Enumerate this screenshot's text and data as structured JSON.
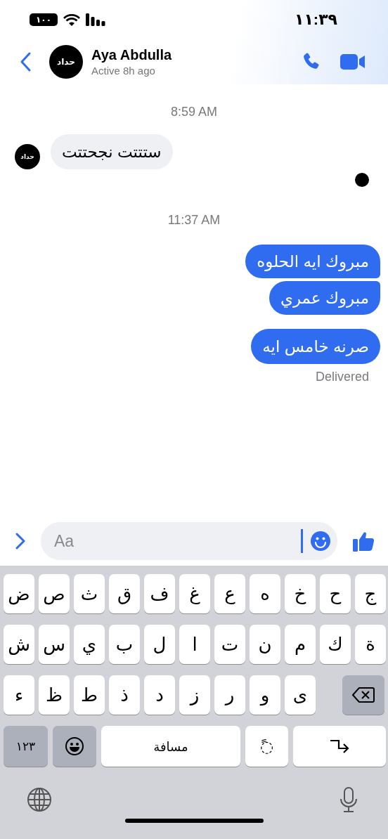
{
  "status_bar": {
    "battery": "١٠٠",
    "time": "١١:٣٩"
  },
  "header": {
    "avatar_text": "حداد",
    "name": "Aya Abdulla",
    "status": "Active 8h ago"
  },
  "messages": [
    {
      "kind": "time",
      "text": "8:59 AM"
    },
    {
      "kind": "received",
      "text": "ستتتت نجحتتت",
      "avatar_text": "حداد"
    },
    {
      "kind": "seen"
    },
    {
      "kind": "time",
      "text": "11:37 AM"
    },
    {
      "kind": "sent",
      "text": "مبروك ايه الحلوه",
      "joined_below": true
    },
    {
      "kind": "sent",
      "text": "مبروك عمري",
      "joined_below": false
    },
    {
      "kind": "sent",
      "text": "صرنه خامس ايه",
      "joined_below": false
    },
    {
      "kind": "receipt",
      "text": "Delivered"
    }
  ],
  "composer": {
    "placeholder": "Aa"
  },
  "keyboard": {
    "rows": [
      [
        {
          "kind": "letter",
          "label": "ج"
        },
        {
          "kind": "letter",
          "label": "ح"
        },
        {
          "kind": "letter",
          "label": "خ"
        },
        {
          "kind": "letter",
          "label": "ه"
        },
        {
          "kind": "letter",
          "label": "ع"
        },
        {
          "kind": "letter",
          "label": "غ"
        },
        {
          "kind": "letter",
          "label": "ف"
        },
        {
          "kind": "letter",
          "label": "ق"
        },
        {
          "kind": "letter",
          "label": "ث"
        },
        {
          "kind": "letter",
          "label": "ص"
        },
        {
          "kind": "letter",
          "label": "ض"
        }
      ],
      [
        {
          "kind": "letter",
          "label": "ة"
        },
        {
          "kind": "letter",
          "label": "ك"
        },
        {
          "kind": "letter",
          "label": "م"
        },
        {
          "kind": "letter",
          "label": "ن"
        },
        {
          "kind": "letter",
          "label": "ت"
        },
        {
          "kind": "letter",
          "label": "ا"
        },
        {
          "kind": "letter",
          "label": "ل"
        },
        {
          "kind": "letter",
          "label": "ب"
        },
        {
          "kind": "letter",
          "label": "ي"
        },
        {
          "kind": "letter",
          "label": "س"
        },
        {
          "kind": "letter",
          "label": "ش"
        }
      ],
      [
        {
          "kind": "backspace"
        },
        {
          "kind": "gap"
        },
        {
          "kind": "letter",
          "label": "ى"
        },
        {
          "kind": "letter",
          "label": "و"
        },
        {
          "kind": "letter",
          "label": "ر"
        },
        {
          "kind": "letter",
          "label": "ز"
        },
        {
          "kind": "letter",
          "label": "د"
        },
        {
          "kind": "letter",
          "label": "ذ"
        },
        {
          "kind": "letter",
          "label": "ط"
        },
        {
          "kind": "letter",
          "label": "ظ"
        },
        {
          "kind": "letter",
          "label": "ء"
        }
      ]
    ],
    "function_row": [
      {
        "kind": "return"
      },
      {
        "kind": "diacritic",
        "label": "◌ً"
      },
      {
        "kind": "space",
        "label": "مسافة"
      },
      {
        "kind": "emoji"
      },
      {
        "kind": "numbers",
        "label": "١٢٣"
      }
    ]
  }
}
